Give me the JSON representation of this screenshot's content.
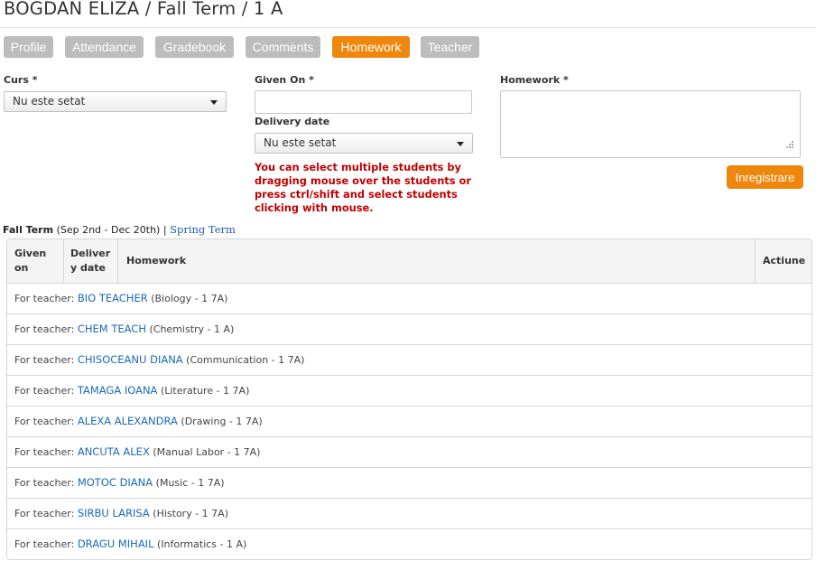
{
  "header": {
    "title": "BOGDAN ELIZA / Fall Term / 1 A"
  },
  "tabs": [
    {
      "label": "Profile",
      "active": false
    },
    {
      "label": "Attendance",
      "active": false
    },
    {
      "label": "Gradebook",
      "active": false
    },
    {
      "label": "Comments",
      "active": false
    },
    {
      "label": "Homework",
      "active": true
    },
    {
      "label": "Teacher",
      "active": false
    }
  ],
  "form": {
    "curs_label": "Curs *",
    "curs_value": "Nu este setat",
    "given_on_label": "Given On *",
    "given_on_value": "",
    "delivery_label": "Delivery date",
    "delivery_value": "Nu este setat",
    "homework_label": "Homework *",
    "homework_value": "",
    "warning": "You can select multiple students by dragging mouse over the students or press ctrl/shift and select students clicking with mouse.",
    "save_label": "Inregistrare"
  },
  "terms": {
    "current": "Fall Term",
    "current_range": "(Sep 2nd - Dec 20th)",
    "separator": "|",
    "other": "Spring Term"
  },
  "table": {
    "headers": {
      "given_on_1": "Given",
      "given_on_2": "on",
      "delivery_1": "Deliver",
      "delivery_2": "y date",
      "homework": "Homework",
      "action": "Actiune"
    },
    "row_prefix": "For teacher:",
    "rows": [
      {
        "teacher": "BIO TEACHER",
        "course": "(Biology - 1 7A)"
      },
      {
        "teacher": "CHEM TEACH",
        "course": "(Chemistry - 1 A)"
      },
      {
        "teacher": "CHISOCEANU DIANA",
        "course": "(Communication - 1 7A)"
      },
      {
        "teacher": "TAMAGA IOANA",
        "course": "(Literature - 1 7A)"
      },
      {
        "teacher": "ALEXA ALEXANDRA",
        "course": "(Drawing - 1 7A)"
      },
      {
        "teacher": "ANCUTA ALEX",
        "course": "(Manual Labor - 1 7A)"
      },
      {
        "teacher": "MOTOC DIANA",
        "course": "(Music - 1 7A)"
      },
      {
        "teacher": "SIRBU LARISA",
        "course": "(History - 1 7A)"
      },
      {
        "teacher": "DRAGU MIHAIL",
        "course": "(Informatics - 1 A)"
      }
    ]
  },
  "colors": {
    "accent": "#f0870d",
    "tab_inactive": "#bcbcbc",
    "link": "#1a6ab8",
    "warning": "#c00000"
  }
}
